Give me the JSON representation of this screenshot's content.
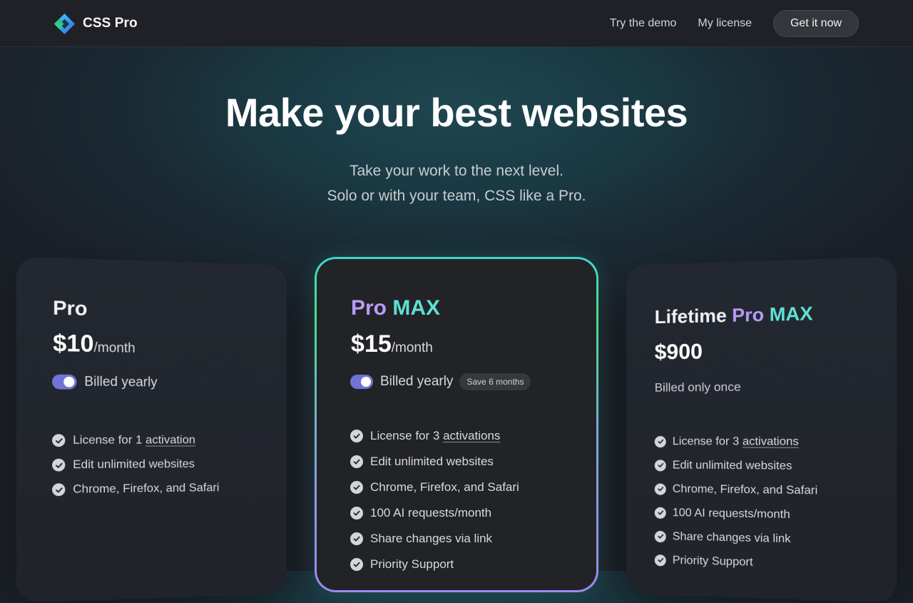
{
  "brand": {
    "name": "CSS Pro",
    "logo_icon": "diamond-logo-icon"
  },
  "nav": {
    "links": [
      "Try the demo",
      "My license"
    ],
    "cta": "Get it now"
  },
  "hero": {
    "title": "Make your best websites",
    "subtitle_lines": [
      "Take your work to the next level.",
      "Solo or with your team, CSS like a Pro."
    ]
  },
  "plans": {
    "pro": {
      "name": "Pro",
      "price": "$10",
      "period": "/month",
      "billing_label": "Billed yearly",
      "billed_yearly": true,
      "features": [
        {
          "before": "License for 1 ",
          "link": "activation"
        },
        {
          "before": "Edit unlimited websites",
          "link": ""
        },
        {
          "before": "Chrome, Firefox, and Safari",
          "link": ""
        }
      ]
    },
    "pro_max": {
      "name_part1": "Pro",
      "name_part2": "MAX",
      "price": "$15",
      "period": "/month",
      "billing_label": "Billed yearly",
      "billed_yearly": true,
      "badge": "Save 6 months",
      "features": [
        {
          "before": "License for 3 ",
          "link": "activations"
        },
        {
          "before": "Edit unlimited websites",
          "link": ""
        },
        {
          "before": "Chrome, Firefox, and Safari",
          "link": ""
        },
        {
          "before": "100 AI requests/month",
          "link": ""
        },
        {
          "before": "Share changes via link",
          "link": ""
        },
        {
          "before": "Priority Support",
          "link": ""
        }
      ]
    },
    "lifetime": {
      "name_prefix": "Lifetime",
      "name_part1": "Pro",
      "name_part2": "MAX",
      "price": "$900",
      "billing_label": "Billed only once",
      "features": [
        {
          "before": "License for 3 ",
          "link": "activations"
        },
        {
          "before": "Edit unlimited websites",
          "link": ""
        },
        {
          "before": "Chrome, Firefox, and Safari",
          "link": ""
        },
        {
          "before": "100 AI requests/month",
          "link": ""
        },
        {
          "before": "Share changes via link",
          "link": ""
        },
        {
          "before": "Priority Support",
          "link": ""
        }
      ]
    }
  },
  "icons": {
    "check": "check-circle-icon"
  },
  "colors": {
    "accent_purple": "#b79cf5",
    "accent_teal": "#5ee0d4",
    "toggle": "#6f74d6"
  }
}
